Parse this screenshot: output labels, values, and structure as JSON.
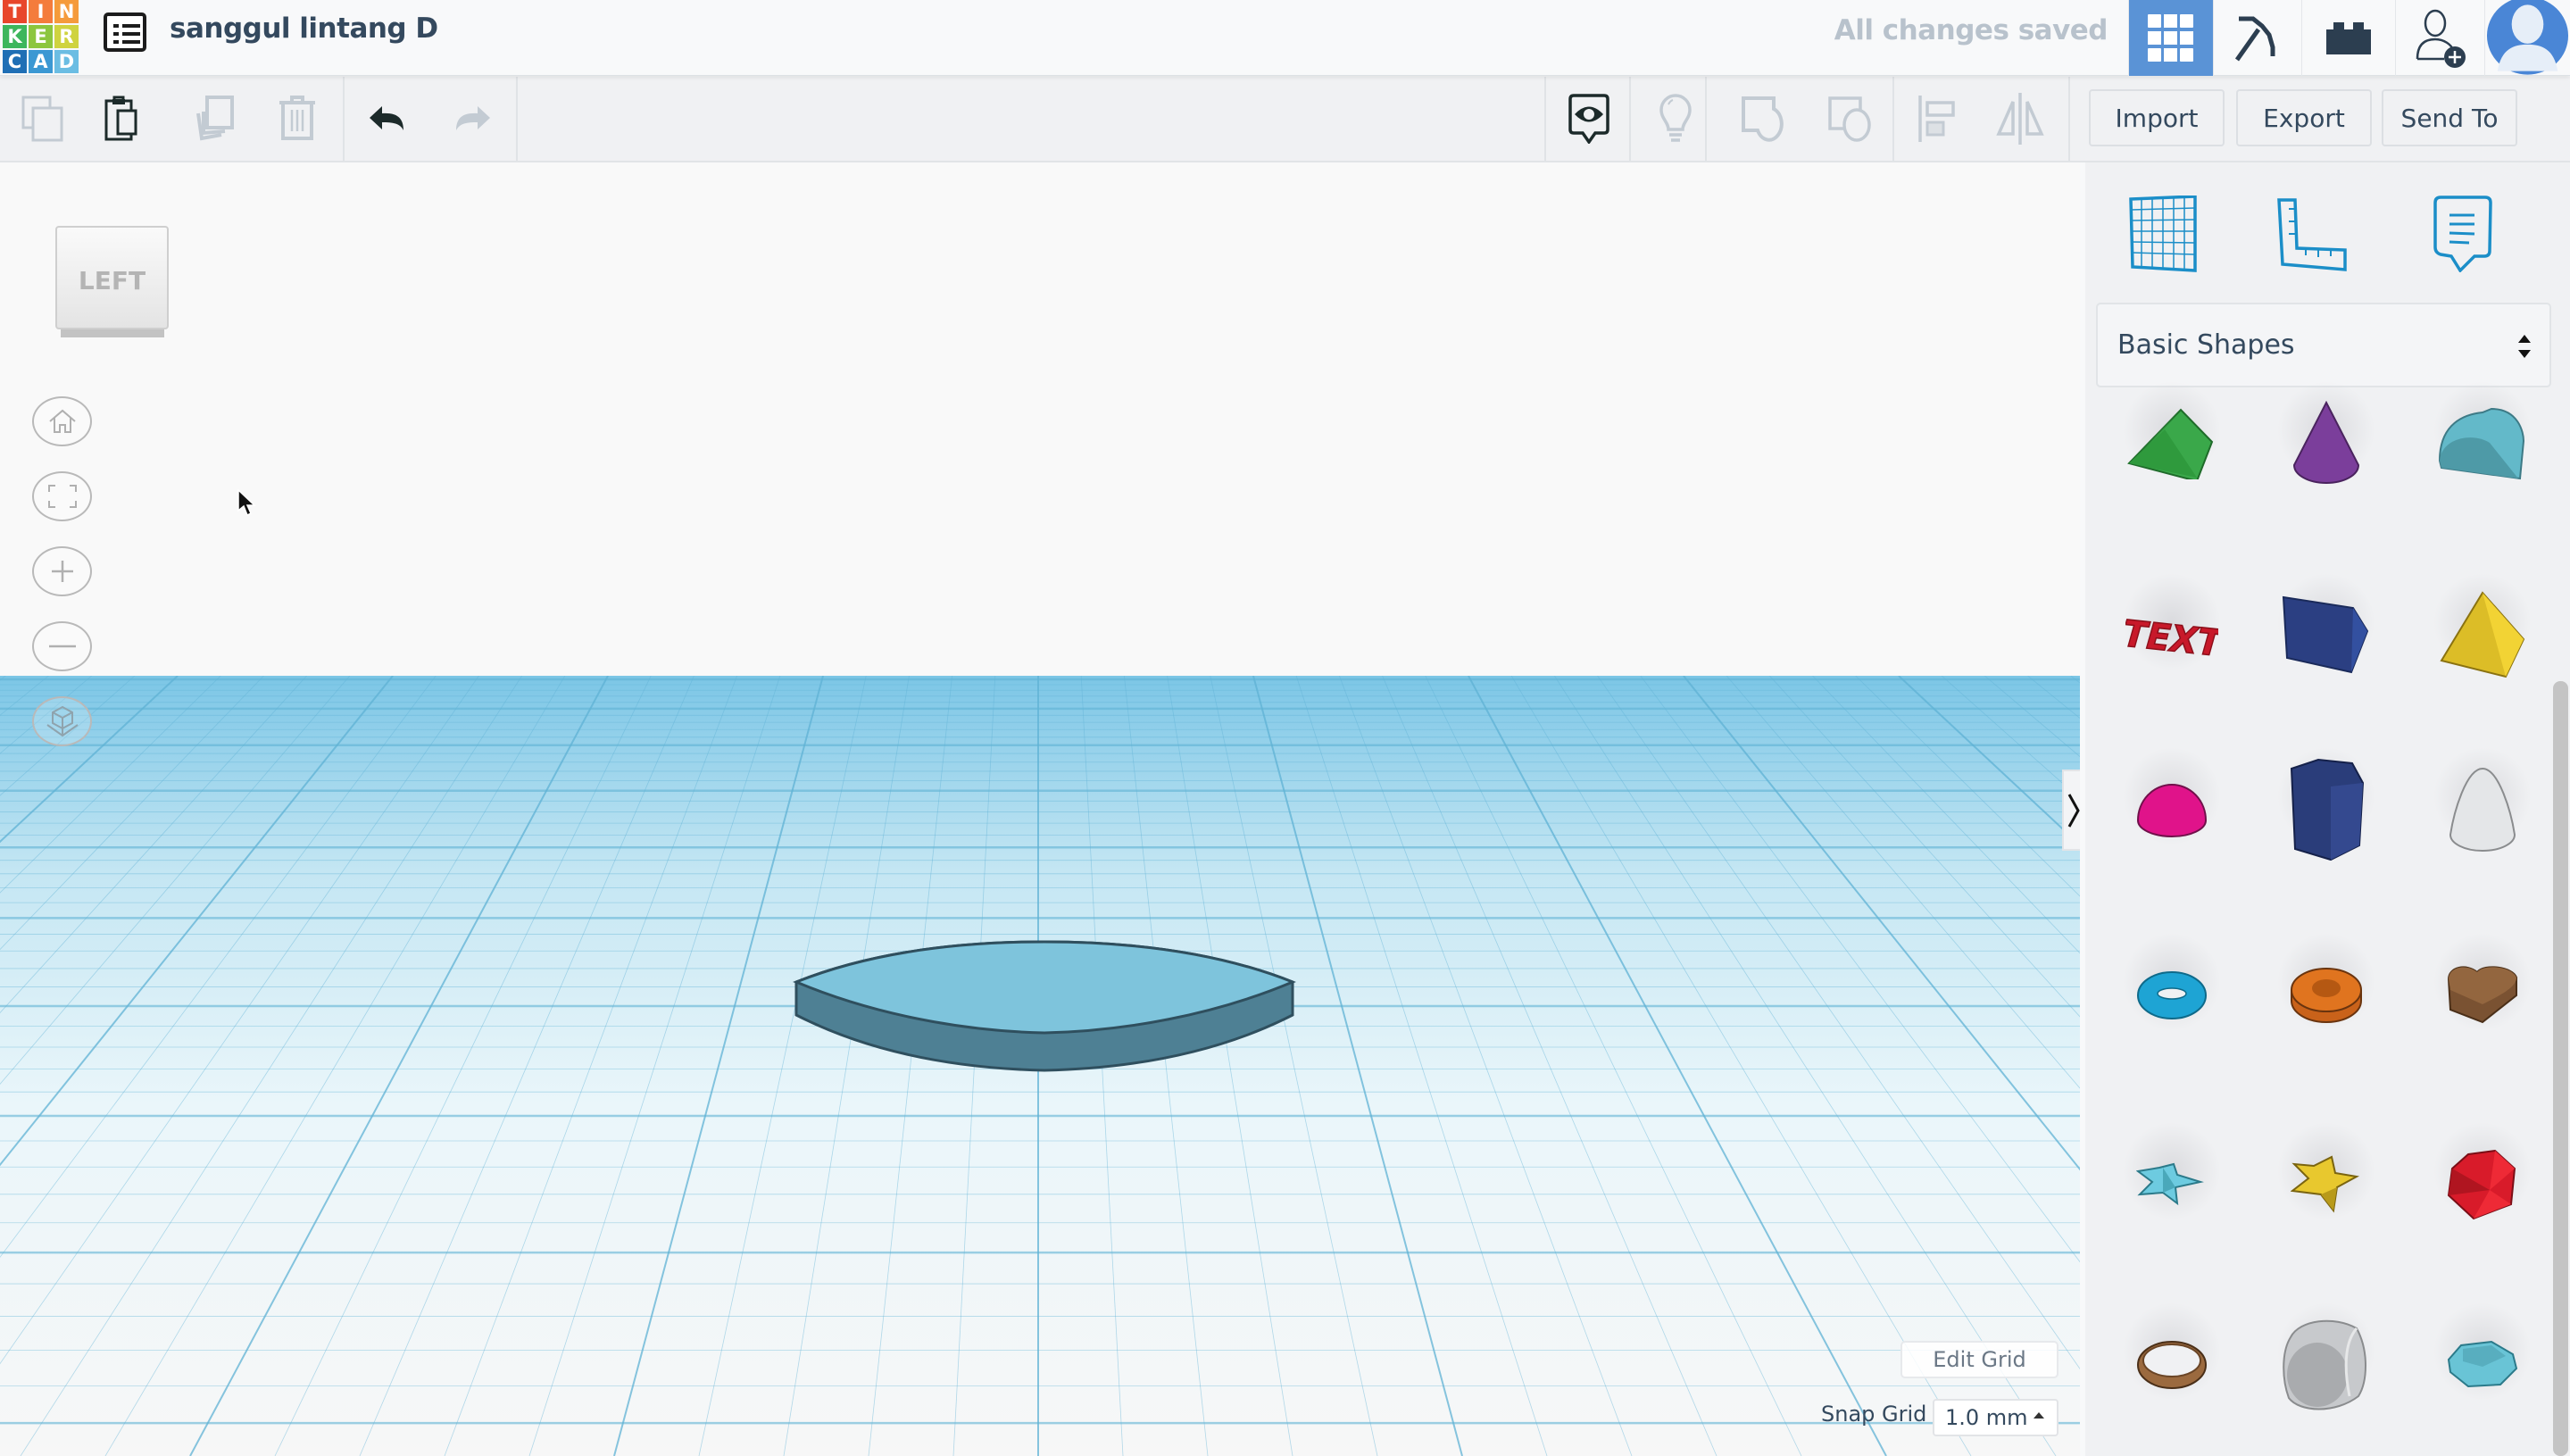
{
  "header": {
    "logo_letters": [
      "T",
      "I",
      "N",
      "K",
      "E",
      "R",
      "C",
      "A",
      "D"
    ],
    "logo_colors": [
      "#e8462b",
      "#f47c3c",
      "#f59b3b",
      "#3db65c",
      "#8cc63e",
      "#cfd33f",
      "#1f6fb5",
      "#3b98d3",
      "#6bbde3"
    ],
    "design_title": "sanggul lintang D",
    "save_status": "All changes saved",
    "accent_color": "#5a93d6"
  },
  "toolbar": {
    "copy": "Copy",
    "paste": "Paste",
    "duplicate": "Duplicate",
    "delete": "Delete",
    "undo": "Undo",
    "redo": "Redo",
    "notes": "Notes",
    "show_all": "Show all",
    "group": "Group",
    "ungroup": "Ungroup",
    "align": "Align",
    "mirror": "Mirror",
    "import_label": "Import",
    "export_label": "Export",
    "send_to_label": "Send To"
  },
  "viewport": {
    "view_cube_label": "LEFT",
    "nav_buttons": [
      "Home view",
      "Fit all",
      "Zoom in",
      "Zoom out",
      "Perspective"
    ],
    "edit_grid_label": "Edit Grid",
    "snap_grid_label": "Snap Grid",
    "snap_grid_value": "1.0 mm",
    "workplane_color": "#7cc6e6",
    "object_color": "#7ec4dc"
  },
  "panel": {
    "tools": [
      "Workplane",
      "Ruler",
      "Notes"
    ],
    "category": "Basic Shapes",
    "shapes": [
      {
        "name": "Roof",
        "color": "#3aa84a"
      },
      {
        "name": "Cone",
        "color": "#7b3e9b"
      },
      {
        "name": "Round Roof",
        "color": "#6ec6d6"
      },
      {
        "name": "Text",
        "color": "#c8192a"
      },
      {
        "name": "Wedge",
        "color": "#2b3f82"
      },
      {
        "name": "Pyramid",
        "color": "#e6c72e"
      },
      {
        "name": "Half Sphere",
        "color": "#e0138a"
      },
      {
        "name": "Polygon",
        "color": "#2e4489"
      },
      {
        "name": "Paraboloid",
        "color": "#e4e6e8"
      },
      {
        "name": "Torus",
        "color": "#1ea4d4"
      },
      {
        "name": "Tube",
        "color": "#e0741f"
      },
      {
        "name": "Heart",
        "color": "#93663f"
      },
      {
        "name": "Star",
        "color": "#6dcbe0"
      },
      {
        "name": "Star",
        "color": "#e8c82e"
      },
      {
        "name": "Icosahedron",
        "color": "#d81b2a"
      },
      {
        "name": "Ring",
        "color": "#9b6a3f"
      },
      {
        "name": "Round Cube",
        "color": "#c7c9cc"
      },
      {
        "name": "Diamond",
        "color": "#69c4d6"
      }
    ]
  }
}
